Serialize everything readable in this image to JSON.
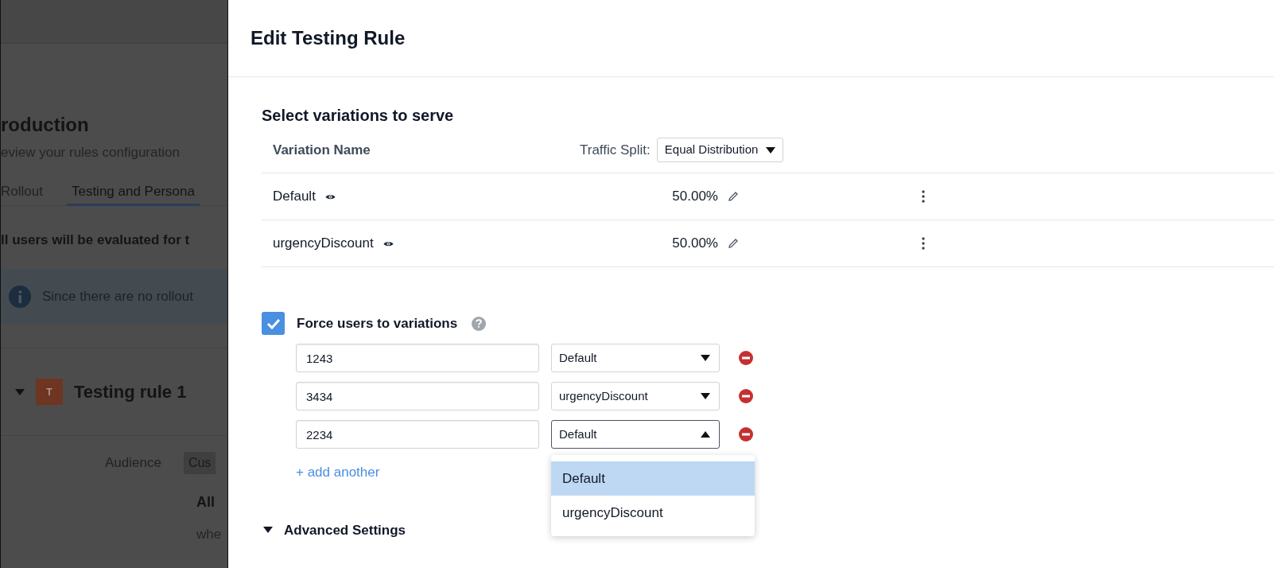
{
  "background": {
    "title": "roduction",
    "subtitle": "eview your rules configuration",
    "tabs": [
      {
        "label": "Rollout",
        "selected": false
      },
      {
        "label": "Testing and Persona",
        "selected": true
      }
    ],
    "notice": "ll users will be evaluated for t",
    "info": "Since there are no rollout",
    "rule": {
      "avatar": "T",
      "name": "Testing rule 1",
      "expanded": true
    },
    "audience_label": "Audience",
    "audience_chip": "Cus",
    "text_1": "All",
    "text_2": "whe"
  },
  "dialog": {
    "title": "Edit Testing Rule",
    "section_title": "Select variations to serve",
    "column_name": "Variation Name",
    "traffic_label": "Traffic Split:",
    "traffic_value": "Equal Distribution",
    "rows": [
      {
        "name": "Default",
        "split": "50.00%"
      },
      {
        "name": "urgencyDiscount",
        "split": "50.00%"
      }
    ],
    "force": {
      "label": "Force users to variations",
      "checked": true
    },
    "overrides": [
      {
        "user_id": "1243",
        "variation": "Default",
        "open": false
      },
      {
        "user_id": "3434",
        "variation": "urgencyDiscount",
        "open": false
      },
      {
        "user_id": "2234",
        "variation": "Default",
        "open": true
      }
    ],
    "options": [
      {
        "label": "Default",
        "selected": true
      },
      {
        "label": "urgencyDiscount",
        "selected": false
      }
    ],
    "add_link": "+ add another",
    "advanced": {
      "label": "Advanced Settings",
      "expanded": true
    }
  }
}
